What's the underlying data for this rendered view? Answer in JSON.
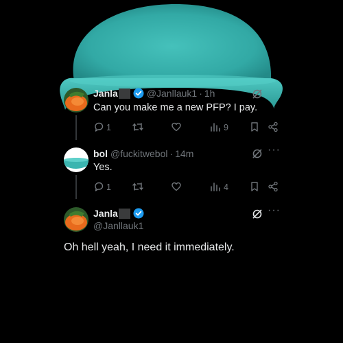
{
  "colors": {
    "background": "#000000",
    "text": "#e7e9ea",
    "muted": "#71767b",
    "verified": "#1d9bf0",
    "bowl": "#3bb5b0"
  },
  "tweets": [
    {
      "name": "Janla",
      "handle": "@Janllauk1",
      "time": "1h",
      "text": "Can you make me a new PFP? I pay.",
      "verified": true,
      "actions": {
        "reply": "1",
        "retweet": "",
        "like": "",
        "views": "9"
      }
    },
    {
      "name": "bol",
      "handle": "@fuckitwebol",
      "time": "14m",
      "text": "Yes.",
      "verified": false,
      "actions": {
        "reply": "1",
        "retweet": "",
        "like": "",
        "views": "4"
      }
    }
  ],
  "main_tweet": {
    "name": "Janla",
    "handle": "@Janllauk1",
    "text": "Oh hell yeah, I need it immediately.",
    "verified": true
  },
  "icons": {
    "reply": "comment-icon",
    "retweet": "retweet-icon",
    "like": "heart-icon",
    "views": "views-icon",
    "bookmark": "bookmark-icon",
    "share": "share-icon",
    "grok": "grok-icon",
    "more": "more-icon"
  }
}
